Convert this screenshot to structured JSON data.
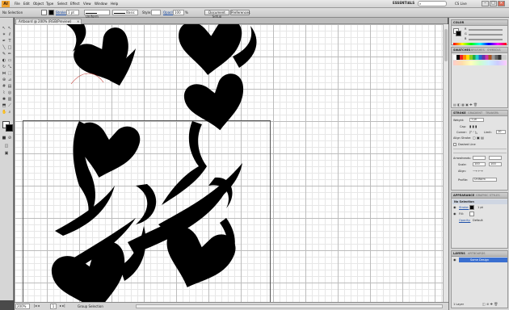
{
  "app": {
    "logo": "Ai"
  },
  "menubar": {
    "items": [
      "File",
      "Edit",
      "Object",
      "Type",
      "Select",
      "Effect",
      "View",
      "Window",
      "Help"
    ],
    "workspace": "ESSENTIALS",
    "search_placeholder": "",
    "cslive": "CS Live"
  },
  "control_bar": {
    "selection": "No Selection",
    "stroke_label": "Stroke:",
    "stroke_value": "1 pt",
    "stroke_profile": "Uniform",
    "brush": "Basic",
    "style_label": "Style:",
    "opacity_label": "Opacity:",
    "opacity_value": "100",
    "doc_setup": "Document Setup",
    "preferences": "Preferences"
  },
  "document": {
    "tab_title": "Artboard @ 200% (RGB/Preview)",
    "zoom": "200%",
    "artboard_number": "1",
    "status": "Group Selection"
  },
  "colors": {
    "accent": "#3a6fd0",
    "artwork": "#000000",
    "stroke_highlight": "#c0332b"
  },
  "panels": {
    "color": {
      "title": "COLOR",
      "rows": [
        "R",
        "G",
        "B"
      ]
    },
    "swatches": {
      "tabs": [
        "SWATCHES",
        "BRUSHES",
        "SYMBOLS"
      ]
    },
    "stroke": {
      "tabs": [
        "STROKE",
        "GRADIENT",
        "TRANSPA"
      ],
      "weight_label": "Weight:",
      "weight_value": "1 pt",
      "cap_label": "Cap:",
      "corner_label": "Corner:",
      "limit_label": "Limit:",
      "limit_value": "10",
      "align_label": "Align Stroke:",
      "dashed_label": "Dashed Line",
      "arrowheads_label": "Arrowheads:",
      "scale_label": "Scale:",
      "scale_values": [
        "100",
        "100"
      ],
      "align_arrow_label": "Align:",
      "profile_label": "Profile:",
      "profile_value": "Uniform"
    },
    "appearance": {
      "tabs": [
        "APPEARANCE",
        "GRAPHIC STYLES"
      ],
      "title": "No Selection",
      "stroke_label": "Stroke:",
      "stroke_value": "1 pt",
      "fill_label": "Fill:",
      "opacity_label": "Opacity:",
      "opacity_value": "Default"
    },
    "layers": {
      "tabs": [
        "LAYERS",
        "ARTBOARDS"
      ],
      "layer_name": "Some Design",
      "footer": "1 Layer"
    }
  }
}
